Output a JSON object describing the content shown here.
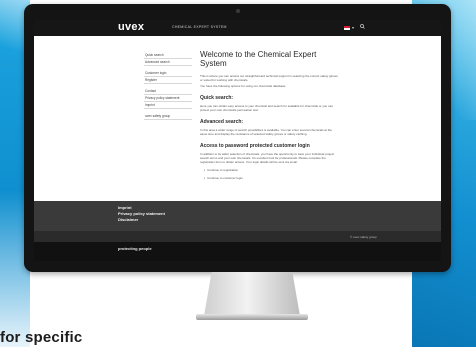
{
  "header": {
    "logo": "uvex",
    "title": "CHEMICAL EXPERT SYSTEM",
    "language_caret": "▾",
    "search_icon": "search-icon"
  },
  "sidebar": {
    "items": [
      {
        "label": "Quick search"
      },
      {
        "label": "Advanced search"
      },
      {
        "label": "Customer login"
      },
      {
        "label": "Register"
      },
      {
        "label": "Contact"
      },
      {
        "label": "Privacy policy statement"
      },
      {
        "label": "Imprint"
      },
      {
        "label": "uvex safety group"
      }
    ]
  },
  "main": {
    "title": "Welcome to the Chemical Expert System",
    "intro": "This is where you can access our straightforward technical support in selecting the correct safety gloves or suited for working with chemicals.",
    "intro_2": "You have the following options for using our chemicals database:",
    "quick": {
      "heading": "Quick search:",
      "text": "Here you can obtain easy access to your chemical and search for available for chemicals or you can protect your own chemicals permeation test."
    },
    "advanced": {
      "heading": "Advanced search:",
      "text": "In this area a wider range of search possibilities is available. You can enter several chemicals at the same time and display the resistance of selected safety gloves or safety clothing."
    },
    "protected": {
      "heading": "Access to password protected customer login",
      "text": "In addition to its wider selection of chemicals, you have the opportunity to save your individual project search terms and your own chemicals. It's excellent tool for professionals. Please complete the registration form to obtain access. Your login details will be sent via email.",
      "link_1": "Continue to registration",
      "link_2": "Continue to customer login"
    }
  },
  "footer": {
    "links": [
      "Imprint",
      "Privacy policy statement",
      "Disclaimer"
    ],
    "copyright": "© uvex safety group",
    "tagline": "protecting people"
  },
  "caption": "for specific",
  "colors": {
    "header": "#161616",
    "footer": "#3a3a3a",
    "tagline_bar": "#111111",
    "accent_blue": "#1596d4"
  }
}
